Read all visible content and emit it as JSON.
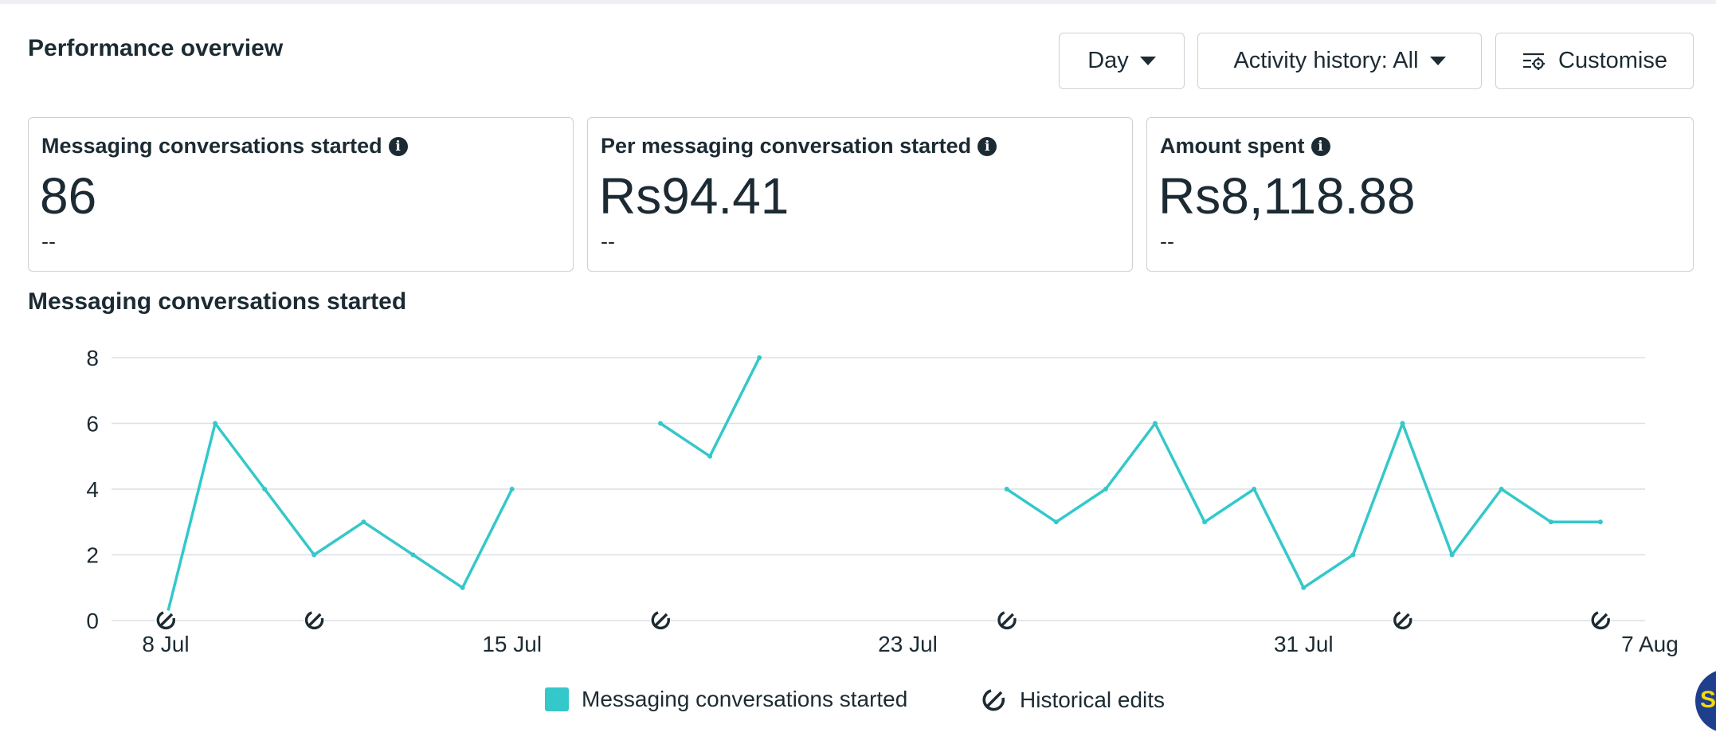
{
  "header": {
    "title": "Performance overview",
    "day_label": "Day",
    "activity_label": "Activity history: All",
    "customise_label": "Customise"
  },
  "metrics": [
    {
      "label": "Messaging conversations started",
      "value": "86",
      "compare": "--"
    },
    {
      "label": "Per messaging conversation started",
      "value": "Rs94.41",
      "compare": "--"
    },
    {
      "label": "Amount spent",
      "value": "Rs8,118.88",
      "compare": "--"
    }
  ],
  "chart_data": {
    "type": "line",
    "title": "Messaging conversations started",
    "x_tick_labels": [
      "8 Jul",
      "15 Jul",
      "23 Jul",
      "31 Jul",
      "7 Aug"
    ],
    "x_tick_days": [
      0,
      7,
      15,
      23,
      30
    ],
    "y_ticks": [
      0,
      2,
      4,
      6,
      8
    ],
    "ylim": [
      0,
      8
    ],
    "grid": true,
    "series": [
      {
        "name": "Messaging conversations started",
        "color": "#34c8cb",
        "segments": [
          [
            [
              0,
              0
            ],
            [
              1,
              6
            ],
            [
              2,
              4
            ],
            [
              3,
              2
            ],
            [
              4,
              3
            ],
            [
              5,
              2
            ],
            [
              6,
              1
            ],
            [
              7,
              4
            ]
          ],
          [
            [
              10,
              6
            ],
            [
              11,
              5
            ],
            [
              12,
              8
            ]
          ],
          [
            [
              17,
              4
            ],
            [
              18,
              3
            ],
            [
              19,
              4
            ],
            [
              20,
              6
            ],
            [
              21,
              3
            ],
            [
              22,
              4
            ],
            [
              23,
              1
            ],
            [
              24,
              2
            ],
            [
              25,
              6
            ],
            [
              26,
              2
            ],
            [
              27,
              4
            ],
            [
              28,
              3
            ],
            [
              29,
              3
            ]
          ]
        ]
      }
    ],
    "historical_edit_days": [
      0,
      3,
      10,
      17,
      25,
      29
    ],
    "legend": [
      "Messaging conversations started",
      "Historical edits"
    ],
    "legend_position": "bottom"
  },
  "legend": {
    "series_label": "Messaging conversations started",
    "edits_label": "Historical edits"
  },
  "colors": {
    "series": "#34c8cb",
    "text": "#1c2b33",
    "grid": "#dddfe3",
    "border": "#ccd0d5"
  },
  "badge": {
    "text": "S"
  }
}
